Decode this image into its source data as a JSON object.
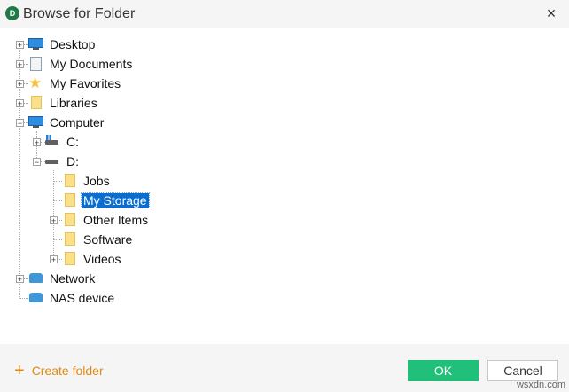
{
  "dialog": {
    "title": "Browse for Folder",
    "close_glyph": "×",
    "app_icon_text": "D"
  },
  "tree": {
    "desktop": "Desktop",
    "my_documents": "My Documents",
    "my_favorites": "My Favorites",
    "libraries": "Libraries",
    "computer": "Computer",
    "drive_c": "C:",
    "drive_d": "D:",
    "jobs": "Jobs",
    "my_storage": "My Storage",
    "other_items": "Other Items",
    "software": "Software",
    "videos": "Videos",
    "network": "Network",
    "nas": "NAS device",
    "selected": "My Storage"
  },
  "footer": {
    "create_folder": "Create folder",
    "create_glyph": "+",
    "ok": "OK",
    "cancel": "Cancel"
  },
  "watermark": "wsxdn.com",
  "colors": {
    "accent_green": "#21c07a",
    "selection_blue": "#0a6ed1",
    "create_orange": "#e08a12"
  }
}
